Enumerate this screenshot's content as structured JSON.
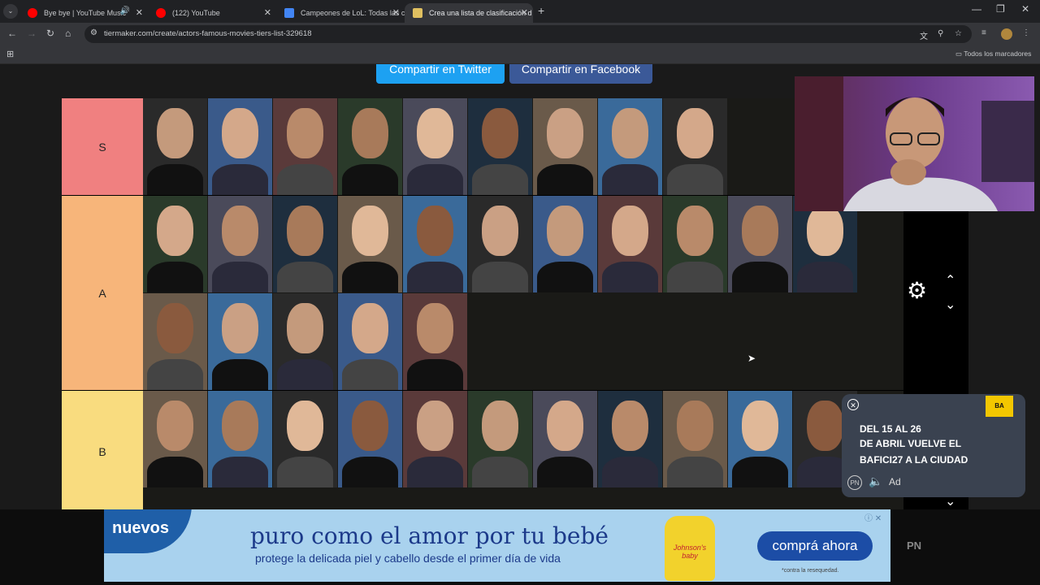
{
  "browser": {
    "tabs": [
      {
        "title": "Bye bye | YouTube Music",
        "favicon_color": "#ff0000"
      },
      {
        "title": "(122) YouTube",
        "favicon_color": "#ff0000"
      },
      {
        "title": "Campeones de LoL: Todas las c",
        "favicon_color": "#4285f4"
      },
      {
        "title": "Crea una lista de clasificación d",
        "favicon_color": "#e0c060"
      }
    ],
    "url": "tiermaker.com/create/actors-famous-movies-tiers-list-329618",
    "bookmarks_folder": "Todos los marcadores"
  },
  "page": {
    "share_twitter": "Compartir en Twitter",
    "share_facebook": "Compartir en Facebook",
    "tiers": [
      {
        "label": "S",
        "color": "#f08080",
        "count": 9
      },
      {
        "label": "A",
        "color": "#f7b57a",
        "count": 16
      },
      {
        "label": "B",
        "color": "#f9dc7f",
        "count": 11
      }
    ]
  },
  "corner_ad": {
    "brand": "BA",
    "line1": "DEL 15 AL 26",
    "line2": "DE ABRIL VUELVE EL",
    "line3": "BAFICI27  A LA CIUDAD",
    "pn": "PN",
    "ad_tag": "Ad"
  },
  "banner_ad": {
    "badge": "nuevos",
    "headline": "puro como el amor por tu bebé",
    "subline": "protege la delicada piel y cabello desde el primer día de vida",
    "cta": "comprá ahora",
    "disclaimer": "*contra la resequedad.",
    "product_brand": "Johnson's baby",
    "pn": "PN"
  }
}
